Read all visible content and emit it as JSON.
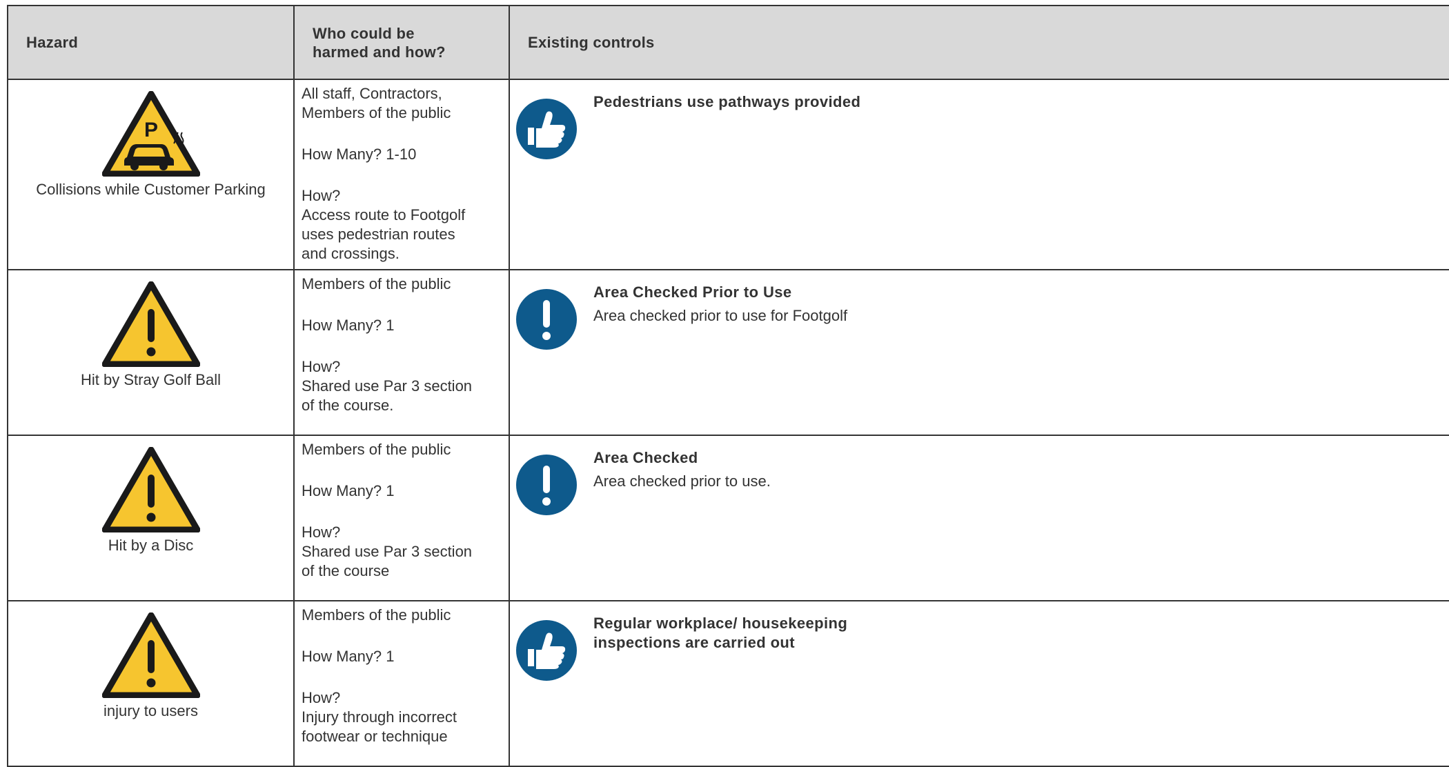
{
  "headers": {
    "hazard": "Hazard",
    "who": "Who could be\nharmed and how?",
    "controls": "Existing controls"
  },
  "colors": {
    "header_bg": "#d9d9d9",
    "warning_yellow": "#f6c52f",
    "badge_blue": "#0e5a8c",
    "border": "#333333"
  },
  "rows": [
    {
      "hazard_icon": "parking-warning-icon",
      "hazard_label": "Collisions while Customer Parking",
      "who": "All staff, Contractors,\nMembers of the public",
      "how_many": "How Many? 1-10",
      "how_label": "How?",
      "how_detail": "Access route to Footgolf\nuses pedestrian routes\nand crossings.",
      "control_icon": "thumbs-up-icon",
      "control_title": "Pedestrians use pathways provided",
      "control_desc": ""
    },
    {
      "hazard_icon": "exclamation-warning-icon",
      "hazard_label": "Hit by Stray Golf Ball",
      "who": "Members of the public",
      "how_many": "How Many? 1",
      "how_label": "How?",
      "how_detail": "Shared use Par 3 section\nof the course.",
      "control_icon": "exclamation-icon",
      "control_title": "Area Checked Prior to Use",
      "control_desc": "Area checked prior to use for Footgolf"
    },
    {
      "hazard_icon": "exclamation-warning-icon",
      "hazard_label": "Hit by a Disc",
      "who": "Members of the public",
      "how_many": "How Many? 1",
      "how_label": "How?",
      "how_detail": "Shared use Par 3 section\nof the course",
      "control_icon": "exclamation-icon",
      "control_title": "Area Checked",
      "control_desc": "Area checked prior to use."
    },
    {
      "hazard_icon": "exclamation-warning-icon",
      "hazard_label": "injury to users",
      "who": "Members of the public",
      "how_many": "How Many? 1",
      "how_label": "How?",
      "how_detail": "Injury through incorrect\nfootwear or technique",
      "control_icon": "thumbs-up-icon",
      "control_title": "Regular workplace/ housekeeping\ninspections are carried out",
      "control_desc": ""
    }
  ]
}
